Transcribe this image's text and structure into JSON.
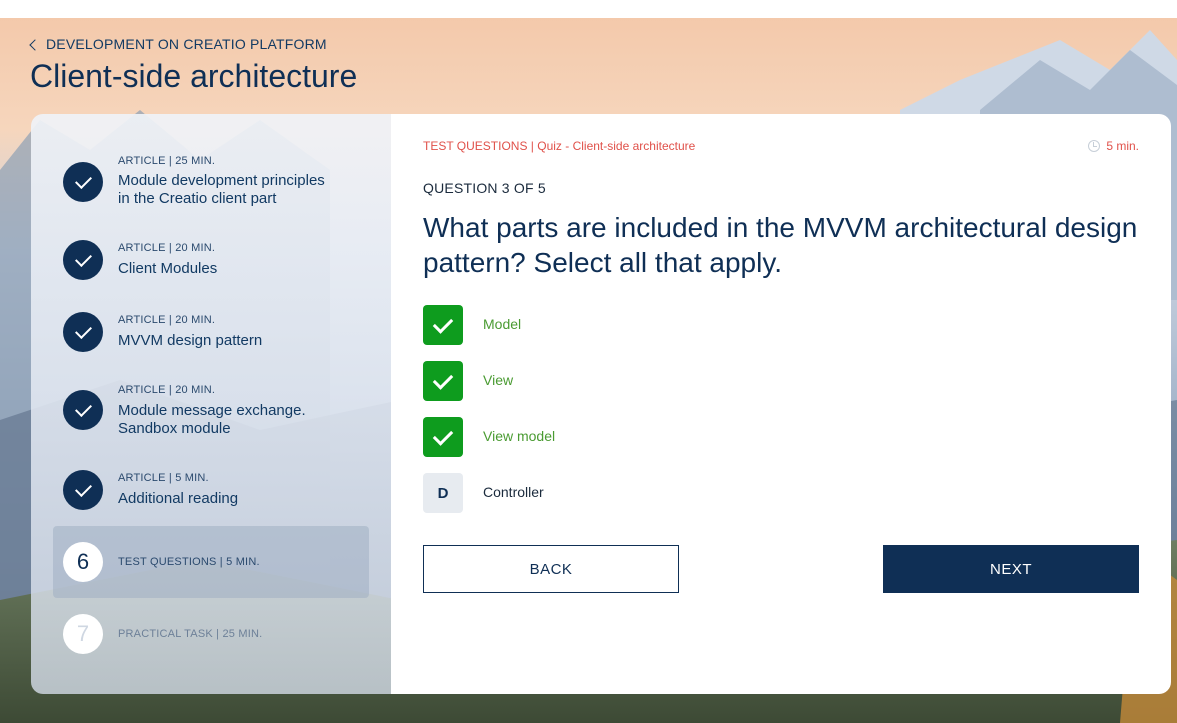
{
  "header": {
    "breadcrumb": "DEVELOPMENT ON CREATIO PLATFORM",
    "title": "Client-side architecture"
  },
  "sidebar": {
    "items": [
      {
        "meta": "ARTICLE | 25 MIN.",
        "name_line1": "Module development principles",
        "name_line2": "in the Creatio client part",
        "state": "completed"
      },
      {
        "meta": "ARTICLE | 20 MIN.",
        "name_line1": "Client Modules",
        "state": "completed"
      },
      {
        "meta": "ARTICLE | 20 MIN.",
        "name_line1": "MVVM design pattern",
        "state": "completed"
      },
      {
        "meta": "ARTICLE | 20 MIN.",
        "name_line1": "Module message exchange.",
        "name_line2": "Sandbox module",
        "state": "completed"
      },
      {
        "meta": "ARTICLE | 5 MIN.",
        "name_line1": "Additional reading",
        "state": "completed"
      },
      {
        "number": "6",
        "meta": "TEST QUESTIONS | 5 MIN.",
        "state": "active"
      },
      {
        "number": "7",
        "meta": "PRACTICAL TASK | 25 MIN.",
        "state": "upcoming"
      }
    ]
  },
  "quiz": {
    "section_label": "TEST QUESTIONS | Quiz - Client-side architecture",
    "duration": "5 min.",
    "question_counter": "QUESTION 3 OF 5",
    "question_text": "What parts are included in the MVVM architectural design pattern? Select all that apply.",
    "options": [
      {
        "label": "Model",
        "selected": true
      },
      {
        "label": "View",
        "selected": true
      },
      {
        "label": "View model",
        "selected": true
      },
      {
        "letter": "D",
        "label": "Controller",
        "selected": false
      }
    ],
    "back_label": "BACK",
    "next_label": "NEXT"
  },
  "colors": {
    "brand_navy": "#0f2f55",
    "selected_green": "#0e9c1e",
    "accent_red": "#e0514a"
  }
}
